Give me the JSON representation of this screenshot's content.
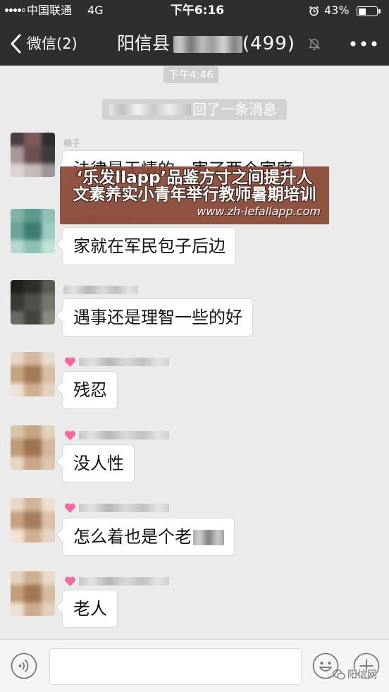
{
  "theme": {
    "header_bg": "#2e2e31",
    "chat_bg": "#ebebeb",
    "overlay_bg": "#8a4836",
    "heart": "#f26aa3"
  },
  "status_bar": {
    "carrier": "中国联通",
    "network": "4G",
    "time": "下午6:16",
    "battery_text": "43%",
    "battery_level": 0.43,
    "icons": [
      "signal-dots-icon",
      "alarm-icon",
      "battery-icon"
    ]
  },
  "header": {
    "back_label": "微信(2)",
    "title_prefix": "阳信县",
    "title_count": "(499)",
    "icons": {
      "back": "chevron-left-icon",
      "mute": "mute-bell-icon",
      "more": "more-dots-icon"
    }
  },
  "chat": {
    "timestamp": "下午4:46",
    "system_message": "回了一条消息",
    "messages": [
      {
        "sender": "楠子",
        "text": "法律是无情的，害了两个家庭",
        "avatar_mosaic": [
          "#4a3e40",
          "#7d5a5a",
          "#2f2f2f",
          "#a89898",
          "#6b5050",
          "#3c3c3c",
          "#ddd3d3",
          "#c6bcbc",
          "#9e9696"
        ]
      },
      {
        "text": "家就在军民包子后边",
        "avatar_mosaic": [
          "#7fb3a8",
          "#5c9a8e",
          "#8fc0b6",
          "#6aa498",
          "#3f7a70",
          "#9ccbc2",
          "#b5d8d0",
          "#8cbfb5",
          "#c0e0d8"
        ]
      },
      {
        "text": "遇事还是理智一些的好",
        "avatar_mosaic": [
          "#1f1f1d",
          "#2e2e2a",
          "#5a5a52",
          "#3a3a34",
          "#50504a",
          "#76766c",
          "#6a6a60",
          "#44443e",
          "#8a8a80"
        ]
      },
      {
        "name_icon": "pink-heart-icon",
        "text": "残忍",
        "avatar_mosaic": [
          "#e6d6c6",
          "#d4b89c",
          "#e8dccf",
          "#c9a280",
          "#a37a5a",
          "#d8bea4",
          "#eee2d6",
          "#cfae90",
          "#e4d2c0"
        ]
      },
      {
        "name_icon": "pink-heart-icon",
        "text": "没人性",
        "avatar_mosaic": [
          "#d9c4a8",
          "#c6a482",
          "#e2d2bc",
          "#bf9a74",
          "#9c7452",
          "#d2b89c",
          "#e6d6c4",
          "#c8a686",
          "#dcc6ae"
        ]
      },
      {
        "name_icon": "pink-heart-icon",
        "text": "怎么着也是个老",
        "avatar_mosaic": [
          "#e8d8c8",
          "#d2b496",
          "#ecdfd2",
          "#c7a07e",
          "#a67e5e",
          "#dac0a6",
          "#f0e4d8",
          "#d0b092",
          "#e6d4c2"
        ]
      },
      {
        "name_icon": "pink-heart-icon",
        "text": "老人",
        "avatar_mosaic": [
          "#e4d2c0",
          "#cfae8e",
          "#e8dac8",
          "#c39c78",
          "#a07654",
          "#d6bc9e",
          "#ece0d2",
          "#ccab8c",
          "#e2cfbc"
        ]
      }
    ]
  },
  "overlay": {
    "line1": "‘乐发llapp’品鉴方寸之间提升人",
    "line2": "文素养实小青年举行教师暑期培训",
    "url": "www.zh-lefallapp.com"
  },
  "input_bar": {
    "icons": {
      "voice": "voice-icon",
      "emoji": "emoji-icon",
      "more": "plus-icon"
    }
  },
  "watermark": {
    "text": "阳信网",
    "icon": "wechat-logo-icon"
  }
}
